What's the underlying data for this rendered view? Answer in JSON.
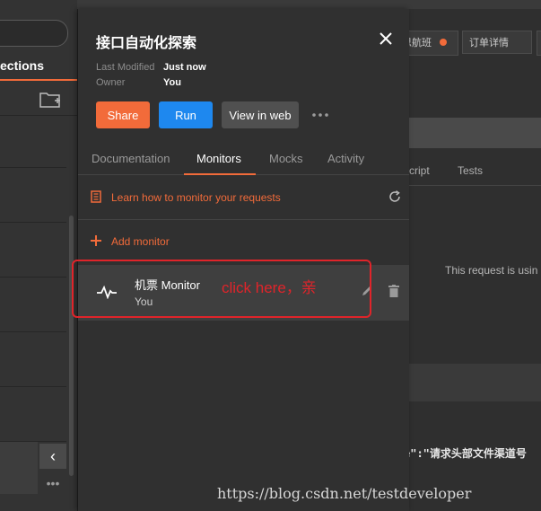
{
  "sidebar": {
    "tab_label": "ections",
    "more_label": "•••",
    "collapse_label": "‹"
  },
  "background": {
    "tabs": [
      {
        "label": "思航班"
      },
      {
        "label": "订单详情"
      }
    ],
    "request_tabs": [
      "cript",
      "Tests"
    ],
    "request_info": "This request is usin",
    "response_snippet": "e\":\"请求头部文件渠道号"
  },
  "panel": {
    "title": "接口自动化探索",
    "meta": {
      "last_modified_label": "Last Modified",
      "last_modified_value": "Just now",
      "owner_label": "Owner",
      "owner_value": "You"
    },
    "buttons": {
      "share": "Share",
      "run": "Run",
      "view_web": "View in web"
    },
    "tabs": [
      {
        "label": "Documentation"
      },
      {
        "label": "Monitors",
        "active": true
      },
      {
        "label": "Mocks"
      },
      {
        "label": "Activity"
      }
    ],
    "learn_link": "Learn how to monitor your requests",
    "add_monitor": "Add monitor",
    "monitor": {
      "name": "机票 Monitor",
      "owner": "You"
    }
  },
  "annotation": {
    "text": "click here，亲",
    "watermark": "https://blog.csdn.net/testdeveloper"
  },
  "colors": {
    "accent_orange": "#f26b3a",
    "run_blue": "#1e88ef",
    "annotation_red": "#e0242a"
  },
  "icons": [
    "close-icon",
    "more-icon",
    "book-icon",
    "refresh-icon",
    "plus-icon",
    "pulse-icon",
    "edit-icon",
    "delete-icon",
    "new-folder-icon"
  ]
}
